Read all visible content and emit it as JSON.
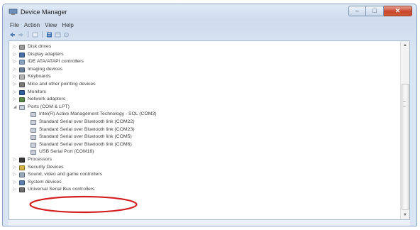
{
  "window": {
    "title": "Device Manager",
    "caption_buttons": {
      "minimize": "–",
      "maximize": "□",
      "close": "✕"
    }
  },
  "menubar": {
    "items": [
      "File",
      "Action",
      "View",
      "Help"
    ]
  },
  "toolbar": {
    "buttons": [
      "back-icon",
      "forward-icon",
      "up-icon",
      "properties-icon",
      "view-icon",
      "help-icon"
    ]
  },
  "tree": {
    "items": [
      {
        "label": "Disk drives",
        "level": 1,
        "expander": "▷",
        "icon": "disk-drive-icon"
      },
      {
        "label": "Display adapters",
        "level": 1,
        "expander": "▷",
        "icon": "display-adapter-icon"
      },
      {
        "label": "IDE ATA/ATAPI controllers",
        "level": 1,
        "expander": "▷",
        "icon": "ide-controller-icon"
      },
      {
        "label": "Imaging devices",
        "level": 1,
        "expander": "▷",
        "icon": "imaging-device-icon"
      },
      {
        "label": "Keyboards",
        "level": 1,
        "expander": "▷",
        "icon": "keyboard-icon"
      },
      {
        "label": "Mice and other pointing devices",
        "level": 1,
        "expander": "▷",
        "icon": "mouse-icon"
      },
      {
        "label": "Monitors",
        "level": 1,
        "expander": "▷",
        "icon": "monitor-icon"
      },
      {
        "label": "Network adapters",
        "level": 1,
        "expander": "▷",
        "icon": "network-adapter-icon"
      },
      {
        "label": "Ports (COM & LPT)",
        "level": 1,
        "expander": "◢",
        "icon": "port-icon"
      },
      {
        "label": "Intel(R) Active Management Technology - SOL (COM3)",
        "level": 2,
        "icon": "port-icon"
      },
      {
        "label": "Standard Serial over Bluetooth link (COM22)",
        "level": 2,
        "icon": "port-icon"
      },
      {
        "label": "Standard Serial over Bluetooth link (COM23)",
        "level": 2,
        "icon": "port-icon"
      },
      {
        "label": "Standard Serial over Bluetooth link (COM5)",
        "level": 2,
        "icon": "port-icon"
      },
      {
        "label": "Standard Serial over Bluetooth link (COM6)",
        "level": 2,
        "icon": "port-icon"
      },
      {
        "label": "USB Serial Port (COM16)",
        "level": 2,
        "icon": "port-icon",
        "highlighted": true
      },
      {
        "label": "Processors",
        "level": 1,
        "expander": "▷",
        "icon": "processor-icon"
      },
      {
        "label": "Security Devices",
        "level": 1,
        "expander": "▷",
        "icon": "security-device-icon"
      },
      {
        "label": "Sound, video and game controllers",
        "level": 1,
        "expander": "▷",
        "icon": "sound-icon"
      },
      {
        "label": "System devices",
        "level": 1,
        "expander": "▷",
        "icon": "system-device-icon"
      },
      {
        "label": "Universal Serial Bus controllers",
        "level": 1,
        "expander": "▷",
        "icon": "usb-controller-icon"
      }
    ]
  },
  "colors": {
    "highlight_ellipse": "#d42020",
    "titlebar": "#cfdcee",
    "close_button": "#c9452b"
  }
}
